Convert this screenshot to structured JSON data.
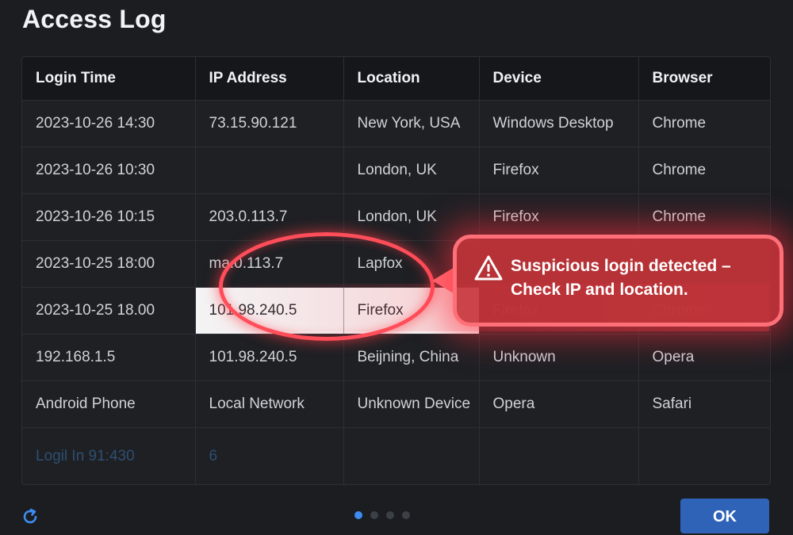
{
  "dialog": {
    "title": "Access Log",
    "ok_label": "OK"
  },
  "table": {
    "headers": [
      "Login Time",
      "IP Address",
      "Location",
      "Device",
      "Browser"
    ],
    "rows": [
      [
        "2023-10-26 14:30",
        "73.15.90.121",
        "New York, USA",
        "Windows Desktop",
        "Chrome"
      ],
      [
        "2023-10-26 10:30",
        "",
        "London, UK",
        "Firefox",
        "Chrome"
      ],
      [
        "2023-10-26 10:15",
        "203.0.113.7",
        "London, UK",
        "Firefox",
        "Chrome"
      ],
      [
        "2023-10-25 18:00",
        "ma.0.113.7",
        "Lapfox",
        "",
        ""
      ],
      [
        "2023-10-25 18.00",
        "101.98.240.5",
        "Firefox",
        "Firefox",
        "Chrome"
      ],
      [
        "192.168.1.5",
        "101.98.240.5",
        "Beijning, China",
        "Unknown",
        "Opera"
      ],
      [
        "Android Phone",
        "Local Network",
        "Unknown Device",
        "Opera",
        "Safari"
      ],
      [
        "Logil In 91:430",
        "6",
        "",
        "",
        ""
      ]
    ]
  },
  "alert": {
    "message": "Suspicious login detected – Check IP and location.",
    "icon": "warning-triangle-icon",
    "color": "#c6343a"
  },
  "pager": {
    "pages": 4,
    "active_page": 1
  },
  "colors": {
    "background": "#1b1d21",
    "accent": "#2f63b8",
    "alert": "#ff4d5a"
  }
}
